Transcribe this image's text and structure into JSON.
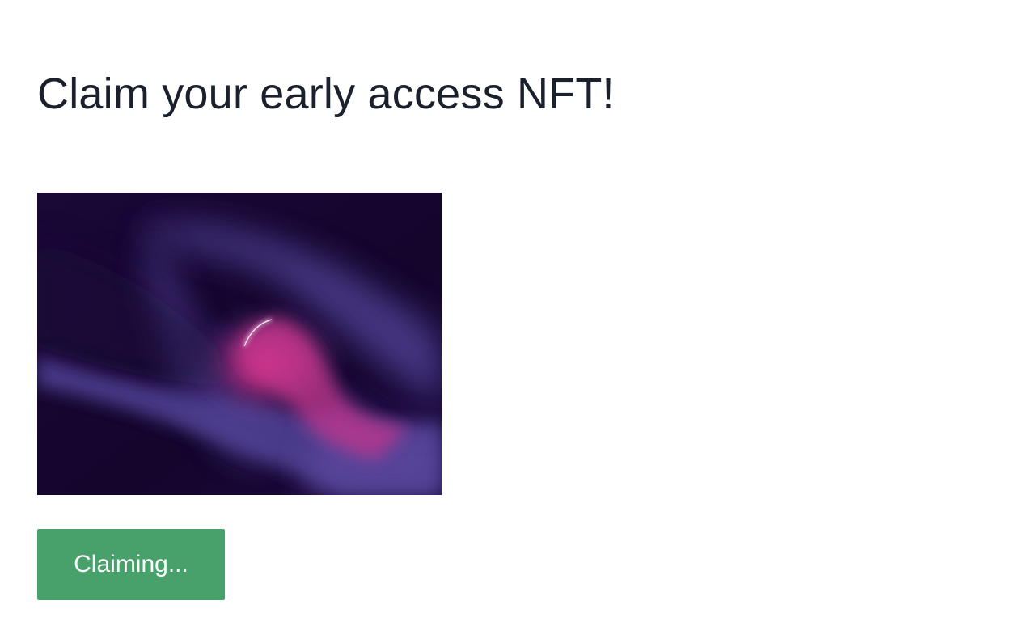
{
  "page": {
    "title": "Claim your early access NFT!"
  },
  "nft": {
    "image_alt": "early access NFT artwork",
    "colors": {
      "background": "#170732",
      "violet": "#4e3d8f",
      "pink": "#ec3b8e"
    }
  },
  "claim": {
    "button_label": "Claiming...",
    "state": "loading",
    "color": "#48a06a"
  }
}
